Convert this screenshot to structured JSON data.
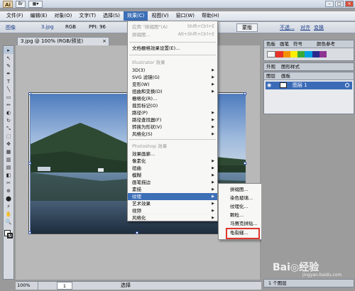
{
  "titlebar": {
    "logo": "Ai",
    "bridge": "Br",
    "layout": "▦▾"
  },
  "menubar": {
    "items": [
      "文件(F)",
      "编辑(E)",
      "对象(O)",
      "文字(T)",
      "选择(S)",
      "效果(C)",
      "视图(V)",
      "窗口(W)",
      "帮助(H)"
    ],
    "active": "效果(C)"
  },
  "controlbar": {
    "image": "图像",
    "file": "3.jpg",
    "mode": "RGB",
    "ppi": "PPI: 96",
    "update_btn": "蒙版",
    "opacity": "不透...",
    "align": "对齐",
    "transform": "变换"
  },
  "doc_tab": {
    "label": "3.jpg @ 100% (RGB/预览)",
    "close": "×"
  },
  "effect_menu": {
    "apply_last": {
      "label": "应用 \"拼缀图\"(A)",
      "shortcut": "Shift+Ctrl+E"
    },
    "last_effect": {
      "label": "拼缀图...",
      "shortcut": "Alt+Shift+Ctrl+E"
    },
    "raster_settings": "文档栅格效果设置(E)...",
    "illustrator_section": "Illustrator 效果",
    "illustrator_items": [
      "3D(3)",
      "SVG 滤镜(G)",
      "变形(W)",
      "扭曲和变换(D)",
      "栅格化(R)...",
      "裁剪标记(O)",
      "路径(P)",
      "路径查找器(F)",
      "转换为形状(V)",
      "风格化(S)"
    ],
    "photoshop_section": "Photoshop 效果",
    "photoshop_items": [
      "效果画廊...",
      "像素化",
      "扭曲",
      "模糊",
      "画笔描边",
      "素描",
      "纹理",
      "艺术效果",
      "视频",
      "锐化",
      "风格化"
    ],
    "highlighted": "纹理"
  },
  "texture_submenu": {
    "items": [
      "拼缀图...",
      "染色玻璃...",
      "纹理化...",
      "颗粒...",
      "马赛克拼贴...",
      "龟裂缝..."
    ],
    "highlighted": "龟裂缝..."
  },
  "swatch_panel": {
    "tabs": [
      "色板",
      "画笔",
      "符号",
      "颜色参考"
    ],
    "colors": [
      "#f4f4f4",
      "#e6332a",
      "#f39200",
      "#ffed00",
      "#3aaa35",
      "#00a0e3",
      "#2a2a8c",
      "#8e3392"
    ]
  },
  "appearance_panel": {
    "tabs": [
      "外观",
      "图形样式"
    ]
  },
  "layers_panel": {
    "tabs": [
      "图层",
      "画板"
    ],
    "layer_name": "图层 1",
    "footer": "1 个图层"
  },
  "statusbar": {
    "zoom": "100%",
    "page": "1",
    "tool": "选择"
  },
  "watermark": {
    "text": "Bai◎经验",
    "sub": "jingyan.baidu.com"
  },
  "tools": [
    "▸",
    "↖",
    "✎",
    "✒",
    "T",
    "╲",
    "▭",
    "✏",
    "◐",
    "↻",
    "⤡",
    "⬚",
    "✥",
    "▦",
    "▥",
    "▤",
    "◧",
    "✂",
    "⊕",
    "⬤",
    "⚡",
    "✋",
    "🔍"
  ]
}
